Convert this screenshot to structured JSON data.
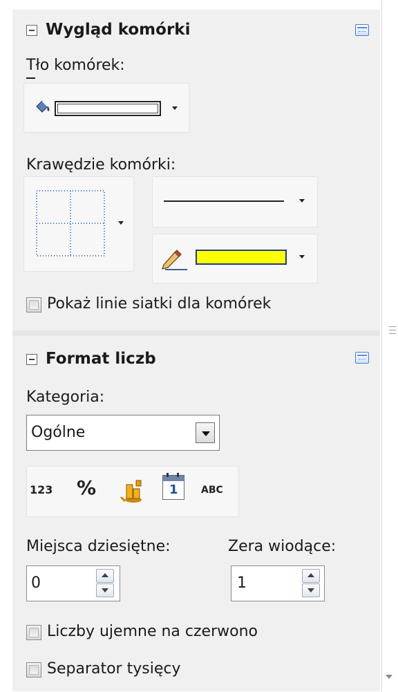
{
  "cell_appearance": {
    "title": "Wygląd komórki",
    "background_label": "Tło komórek:",
    "borders_label": "Krawędzie komórki:",
    "line_color": "#ffff00",
    "show_gridlines_label": "Pokaż linie siatki dla komórek"
  },
  "number_format": {
    "title": "Format liczb",
    "category_label": "Kategoria:",
    "category_value": "Ogólne",
    "format_buttons": {
      "number": "123",
      "percent": "%",
      "currency": "currency-icon",
      "date": "1",
      "text": "ABC"
    },
    "decimal_places_label": "Miejsca dziesiętne:",
    "decimal_places_value": "0",
    "leading_zeros_label": "Zera wiodące:",
    "leading_zeros_value": "1",
    "negative_red_label": "Liczby ujemne na czerwono",
    "thousands_separator_label": "Separator tysięcy"
  }
}
